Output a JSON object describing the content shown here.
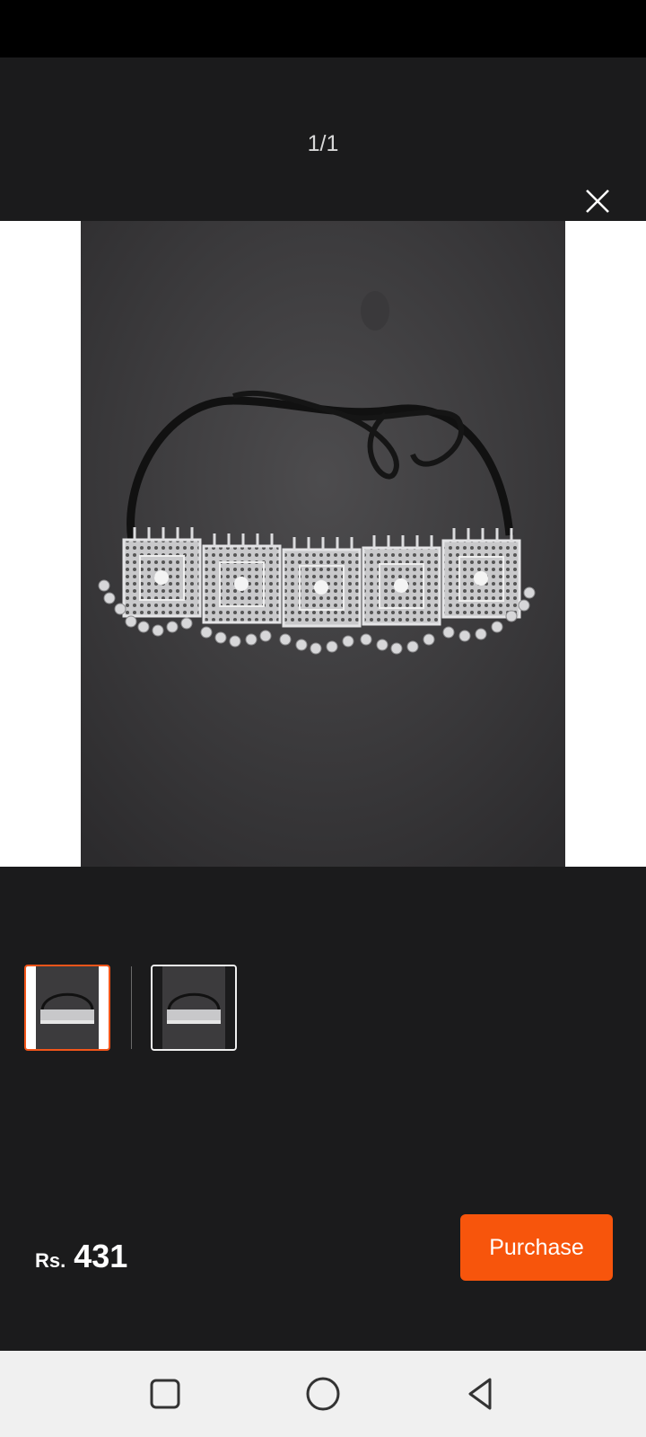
{
  "viewer": {
    "counter": "1/1",
    "close_icon": "close-icon"
  },
  "product": {
    "image_icon": "necklace-photo",
    "thumbnails": [
      {
        "selected": true,
        "icon": "necklace-thumbnail"
      },
      {
        "selected": false,
        "icon": "necklace-thumbnail"
      }
    ]
  },
  "footer": {
    "currency": "Rs.",
    "price": "431",
    "purchase_label": "Purchase"
  },
  "nav": {
    "recents_icon": "square-icon",
    "home_icon": "circle-icon",
    "back_icon": "triangle-back-icon"
  },
  "colors": {
    "accent": "#f7550c",
    "background": "#1b1b1c"
  }
}
